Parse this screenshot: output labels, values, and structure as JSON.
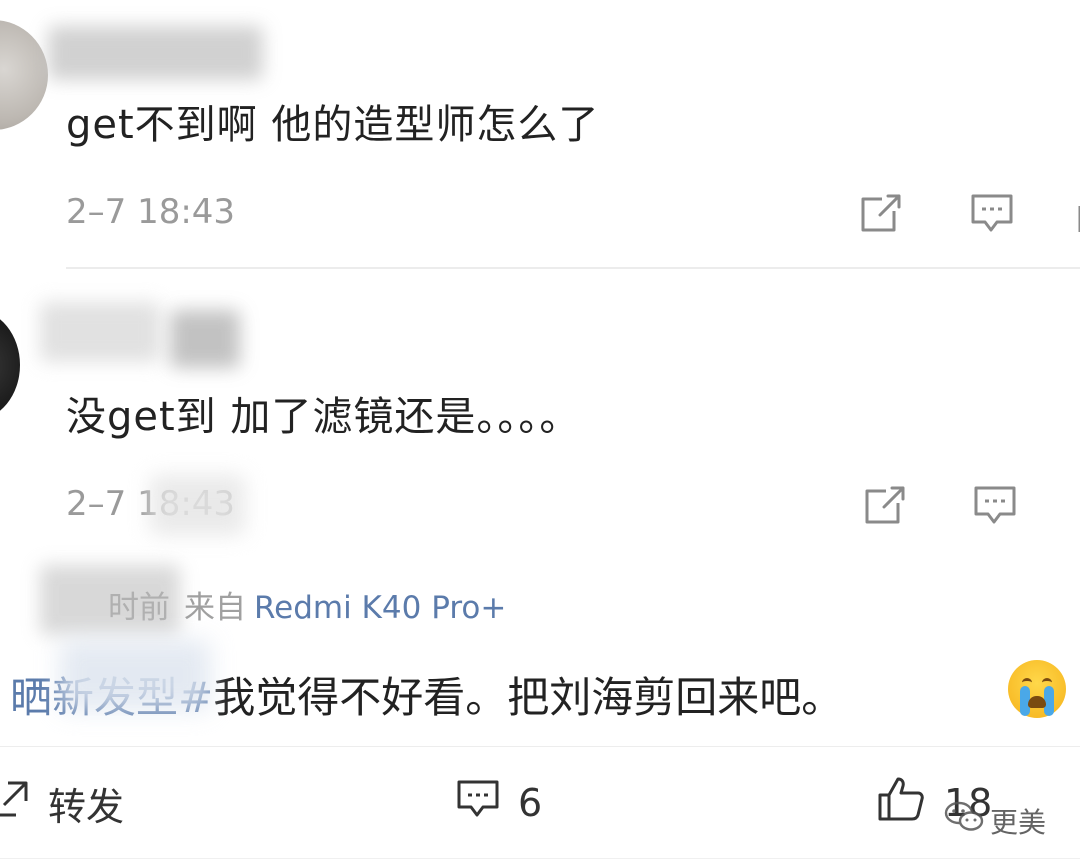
{
  "comments": [
    {
      "text": "get不到啊  他的造型师怎么了",
      "timestamp": "2–7 18:43"
    },
    {
      "text": "没get到 加了滤镜还是。。。。",
      "timestamp": "2–7 18:43"
    }
  ],
  "post": {
    "time_fragment": "时前",
    "source_prefix": "来自",
    "device": "Redmi K40 Pro+",
    "hashtag_fragment": "晒新发型#",
    "text": "我觉得不好看。把刘海剪回来吧。"
  },
  "actions": {
    "repost_label": "转发",
    "comment_count": "6",
    "like_count": "18"
  },
  "watermark": {
    "label": "更美"
  },
  "icons": [
    "share-icon",
    "comment-icon",
    "repost-icon",
    "like-icon",
    "wechat-icon",
    "crying-emoji-icon"
  ],
  "colors": {
    "link": "#5b7bab",
    "text": "#222222",
    "meta": "#9a9a9a"
  }
}
